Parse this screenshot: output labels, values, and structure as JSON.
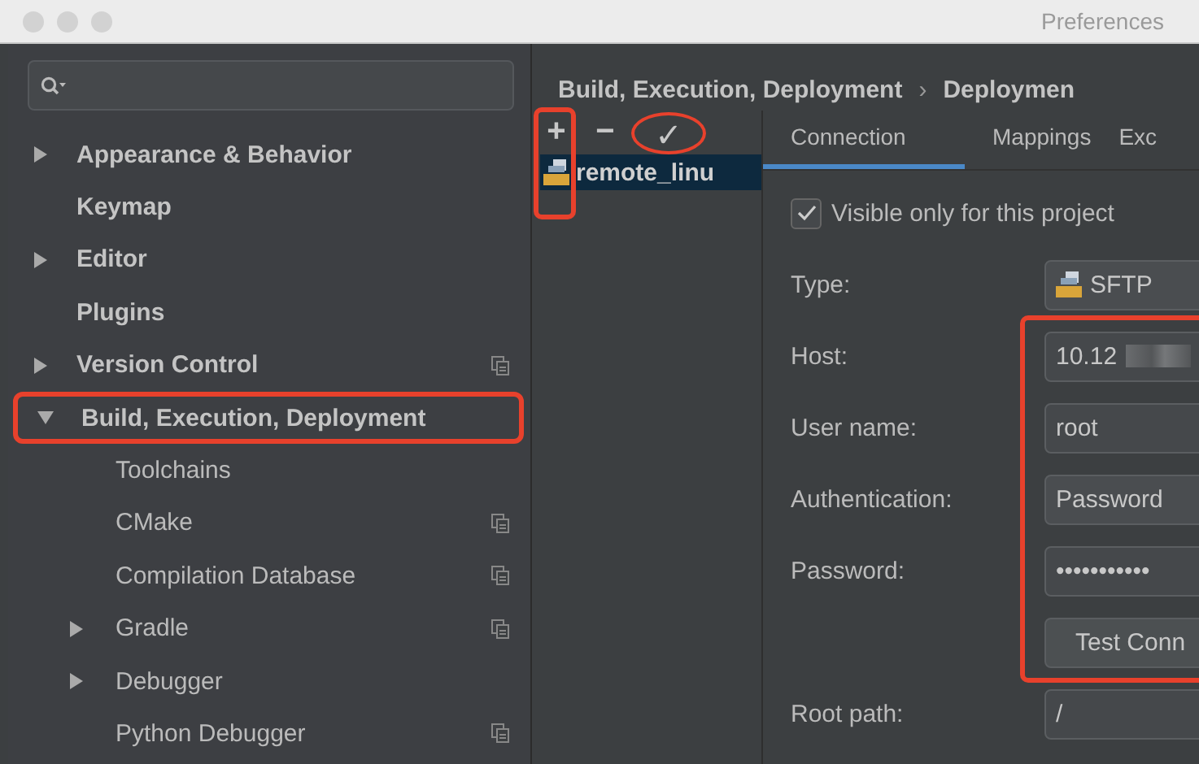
{
  "window": {
    "title": "Preferences"
  },
  "sidebar": {
    "items": [
      {
        "label": "Appearance & Behavior",
        "expandable": true,
        "expanded": false,
        "highlighted": false,
        "project_scope": false
      },
      {
        "label": "Keymap",
        "expandable": false,
        "highlighted": false,
        "project_scope": false
      },
      {
        "label": "Editor",
        "expandable": true,
        "expanded": false,
        "highlighted": false,
        "project_scope": false
      },
      {
        "label": "Plugins",
        "expandable": false,
        "highlighted": false,
        "project_scope": false
      },
      {
        "label": "Version Control",
        "expandable": true,
        "expanded": false,
        "highlighted": false,
        "project_scope": true
      },
      {
        "label": "Build, Execution, Deployment",
        "expandable": true,
        "expanded": true,
        "highlighted": true,
        "project_scope": false,
        "children": [
          {
            "label": "Toolchains",
            "expandable": false,
            "highlighted": false,
            "project_scope": false
          },
          {
            "label": "CMake",
            "expandable": false,
            "highlighted": false,
            "project_scope": true
          },
          {
            "label": "Compilation Database",
            "expandable": false,
            "highlighted": false,
            "project_scope": true
          },
          {
            "label": "Gradle",
            "expandable": true,
            "expanded": false,
            "highlighted": false,
            "project_scope": true
          },
          {
            "label": "Debugger",
            "expandable": true,
            "expanded": false,
            "highlighted": false,
            "project_scope": false
          },
          {
            "label": "Python Debugger",
            "expandable": false,
            "highlighted": false,
            "project_scope": true
          }
        ]
      }
    ]
  },
  "breadcrumb": [
    "Build, Execution, Deployment",
    "›",
    "Deploymen"
  ],
  "toolbar": [
    {
      "kind": "add",
      "label": "+",
      "circled": false
    },
    {
      "kind": "remove",
      "label": "−",
      "circled": false
    },
    {
      "kind": "apply",
      "label": "✓",
      "circled": true
    }
  ],
  "servers": {
    "marked": true,
    "items": [
      {
        "label": "remote_linu",
        "selected": true
      }
    ]
  },
  "tabs": [
    {
      "label": "Connection",
      "selected": true
    },
    {
      "label": "Mappings",
      "selected": false
    },
    {
      "label": "Exc",
      "selected": false
    }
  ],
  "form": [
    {
      "kind": "checkbox",
      "label": "Visible only for this project",
      "checked": true,
      "marked": false
    },
    {
      "kind": "type_select",
      "label": "Type:",
      "value": "SFTP",
      "marked": false
    },
    {
      "kind": "text",
      "label": "Host:",
      "value": "10.12",
      "redacted": true,
      "marked": true
    },
    {
      "kind": "text",
      "label": "User name:",
      "value": "root",
      "redacted": false,
      "marked": true
    },
    {
      "kind": "select",
      "label": "Authentication:",
      "value": "Password",
      "marked": true
    },
    {
      "kind": "password",
      "label": "Password:",
      "value": "•••••••••••",
      "marked": true
    },
    {
      "kind": "button",
      "label": "Test Conn",
      "marked": true
    },
    {
      "kind": "text",
      "label": "Root path:",
      "value": "/",
      "redacted": false,
      "marked": false
    }
  ]
}
